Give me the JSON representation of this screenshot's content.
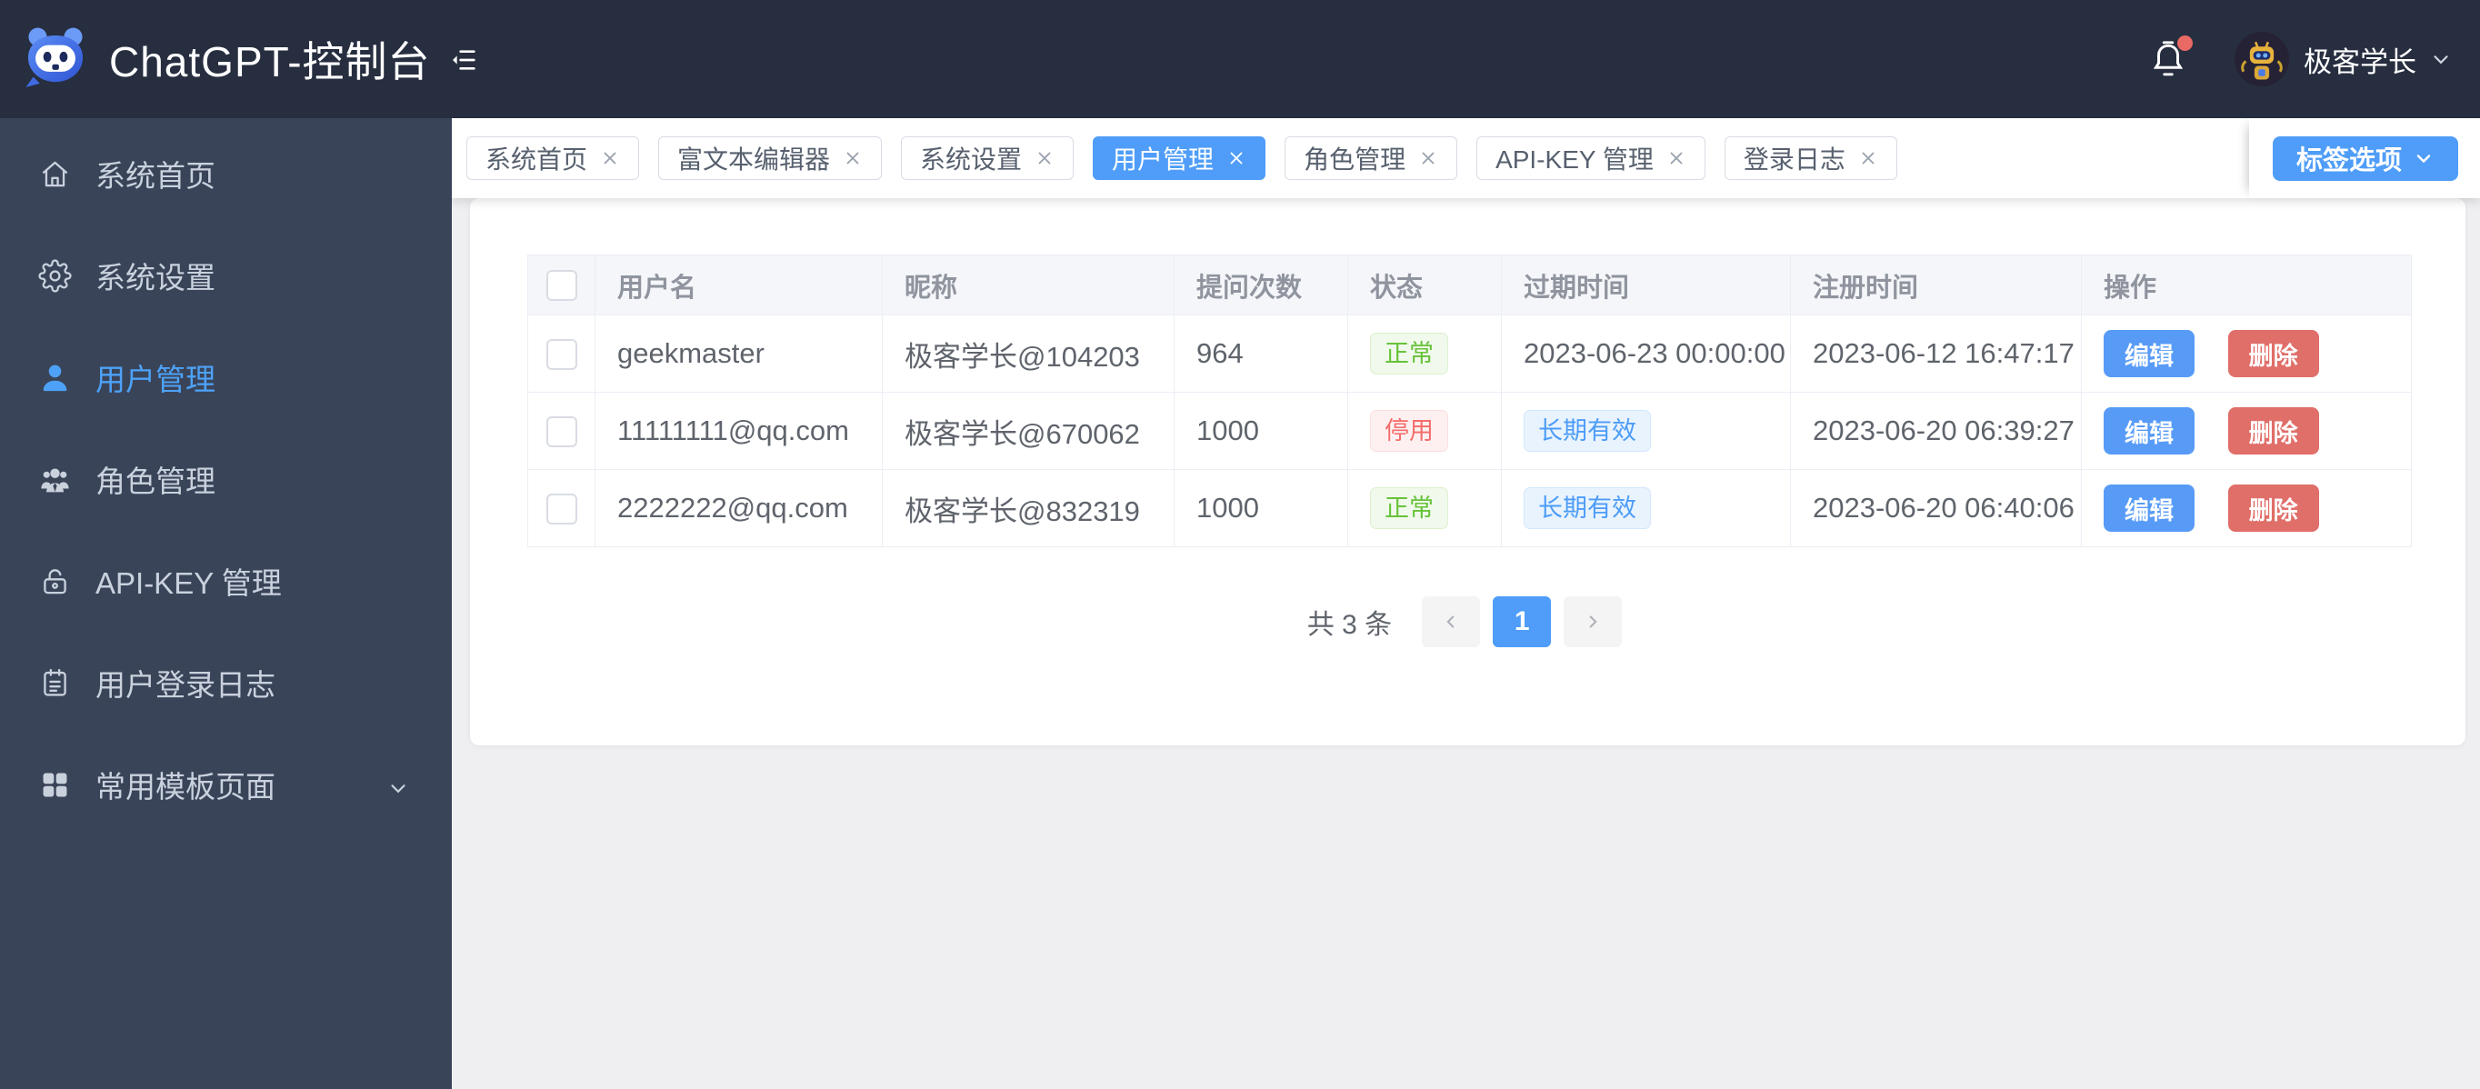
{
  "header": {
    "title": "ChatGPT-控制台",
    "user_name": "极客学长"
  },
  "sidebar": {
    "items": [
      {
        "label": "系统首页",
        "icon": "home-icon",
        "active": false
      },
      {
        "label": "系统设置",
        "icon": "gear-icon",
        "active": false
      },
      {
        "label": "用户管理",
        "icon": "user-icon",
        "active": true
      },
      {
        "label": "角色管理",
        "icon": "users-icon",
        "active": false
      },
      {
        "label": "API-KEY 管理",
        "icon": "lock-icon",
        "active": false
      },
      {
        "label": "用户登录日志",
        "icon": "log-icon",
        "active": false
      },
      {
        "label": "常用模板页面",
        "icon": "grid-icon",
        "active": false,
        "expandable": true
      }
    ]
  },
  "tabbar": {
    "tabs": [
      {
        "label": "系统首页",
        "active": false
      },
      {
        "label": "富文本编辑器",
        "active": false
      },
      {
        "label": "系统设置",
        "active": false
      },
      {
        "label": "用户管理",
        "active": true
      },
      {
        "label": "角色管理",
        "active": false
      },
      {
        "label": "API-KEY 管理",
        "active": false
      },
      {
        "label": "登录日志",
        "active": false
      }
    ],
    "options_button": "标签选项"
  },
  "table": {
    "columns": [
      "用户名",
      "昵称",
      "提问次数",
      "状态",
      "过期时间",
      "注册时间",
      "操作"
    ],
    "rows": [
      {
        "username": "geekmaster",
        "nickname": "极客学长@104203",
        "count": "964",
        "status": "正常",
        "status_type": "success",
        "expire": "2023-06-23 00:00:00",
        "expire_is_tag": false,
        "registered": "2023-06-12 16:47:17"
      },
      {
        "username": "11111111@qq.com",
        "nickname": "极客学长@670062",
        "count": "1000",
        "status": "停用",
        "status_type": "danger",
        "expire": "长期有效",
        "expire_is_tag": true,
        "registered": "2023-06-20 06:39:27"
      },
      {
        "username": "2222222@qq.com",
        "nickname": "极客学长@832319",
        "count": "1000",
        "status": "正常",
        "status_type": "success",
        "expire": "长期有效",
        "expire_is_tag": true,
        "registered": "2023-06-20 06:40:06"
      }
    ],
    "actions": {
      "edit": "编辑",
      "delete": "删除"
    }
  },
  "pagination": {
    "total_text": "共 3 条",
    "page": "1"
  },
  "colors": {
    "header_bg": "#262e3f",
    "sidebar_bg": "#3a4459",
    "accent_blue": "#4f9df8",
    "edit_blue": "#579bf7",
    "delete_red": "#e06e69",
    "success_green": "#67c23a",
    "danger_red": "#f56c6c",
    "notification_dot": "#e96964",
    "content_bg": "#efeff1",
    "table_header_bg": "#f5f6fa",
    "table_border": "#ebeef5"
  }
}
